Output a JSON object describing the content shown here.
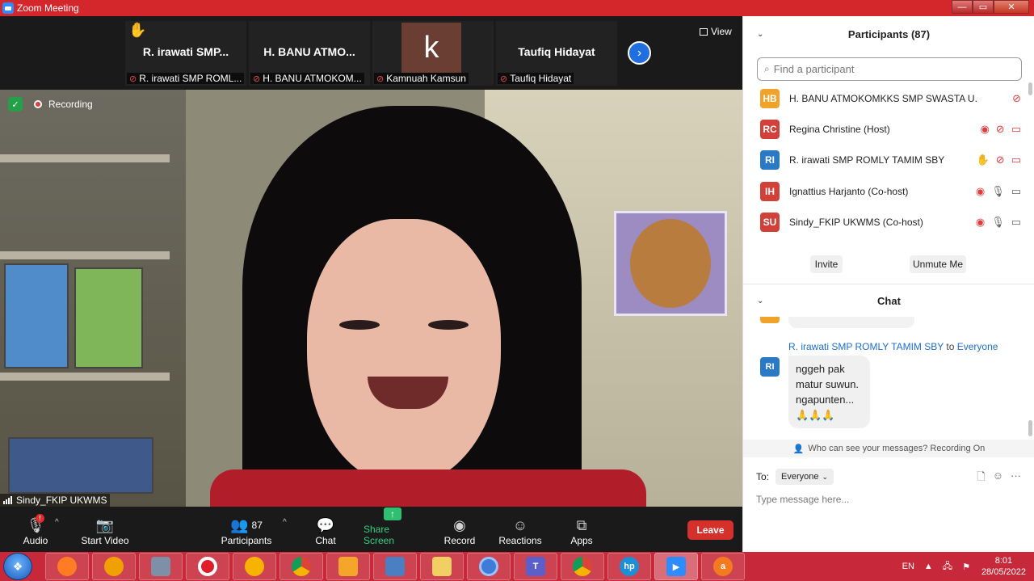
{
  "window": {
    "title": "Zoom Meeting",
    "controls": {
      "minimize": "—",
      "maximize": "▭",
      "close": "✕"
    }
  },
  "strip": {
    "tiles": [
      {
        "display": "R. irawati  SMP...",
        "caption": "R. irawati SMP ROML...",
        "muted": true,
        "hand_raised": true
      },
      {
        "display": "H. BANU  ATMO...",
        "caption": "H. BANU ATMOKOM...",
        "muted": true,
        "hand_raised": false
      },
      {
        "display": "k",
        "caption": "Kamnuah Kamsun",
        "muted": true,
        "hand_raised": false
      },
      {
        "display": "Taufiq Hidayat",
        "caption": "Taufiq Hidayat",
        "muted": true,
        "hand_raised": false
      }
    ],
    "view_label": "View",
    "next_icon": "chevron-right-icon",
    "avatar_color": "#6b3e33"
  },
  "video": {
    "recording_label": "Recording",
    "speaker": "Sindy_FKIP UKWMS"
  },
  "toolbar": {
    "audio": "Audio",
    "start_video": "Start Video",
    "participants": "Participants",
    "participants_count": "87",
    "chat": "Chat",
    "share_screen": "Share Screen",
    "record": "Record",
    "reactions": "Reactions",
    "apps": "Apps",
    "leave": "Leave",
    "audio_alert": "!"
  },
  "participants_panel": {
    "title": "Participants (87)",
    "search_placeholder": "Find a participant",
    "rows": [
      {
        "initials": "HB",
        "color": "#f0a32b",
        "name": "H. BANU ATMOKOMKKS SMP SWASTA U... (Me)"
      },
      {
        "initials": "RC",
        "color": "#d2403a",
        "name": "Regina Christine (Host)"
      },
      {
        "initials": "RI",
        "color": "#2b78c5",
        "name": "R. irawati SMP ROMLY TAMIM SBY"
      },
      {
        "initials": "IH",
        "color": "#d2403a",
        "name": "Ignattius Harjanto (Co-host)"
      },
      {
        "initials": "SU",
        "color": "#d2403a",
        "name": "Sindy_FKIP UKWMS (Co-host)"
      }
    ],
    "invite": "Invite",
    "unmute_me": "Unmute Me"
  },
  "chat_panel": {
    "title": "Chat",
    "message": {
      "sender": "R. irawati SMP ROMLY TAMIM SBY",
      "to_word": "to",
      "recipient": "Everyone",
      "avatar": "RI",
      "lines": [
        "nggeh pak",
        "matur suwun.",
        "ngapunten...",
        "🙏🙏🙏"
      ]
    },
    "visibility_note": "Who can see your messages? Recording On",
    "to_label": "To:",
    "to_value": "Everyone",
    "input_placeholder": "Type message here..."
  },
  "taskbar": {
    "language": "EN",
    "time": "8:01",
    "date": "28/05/2022"
  }
}
